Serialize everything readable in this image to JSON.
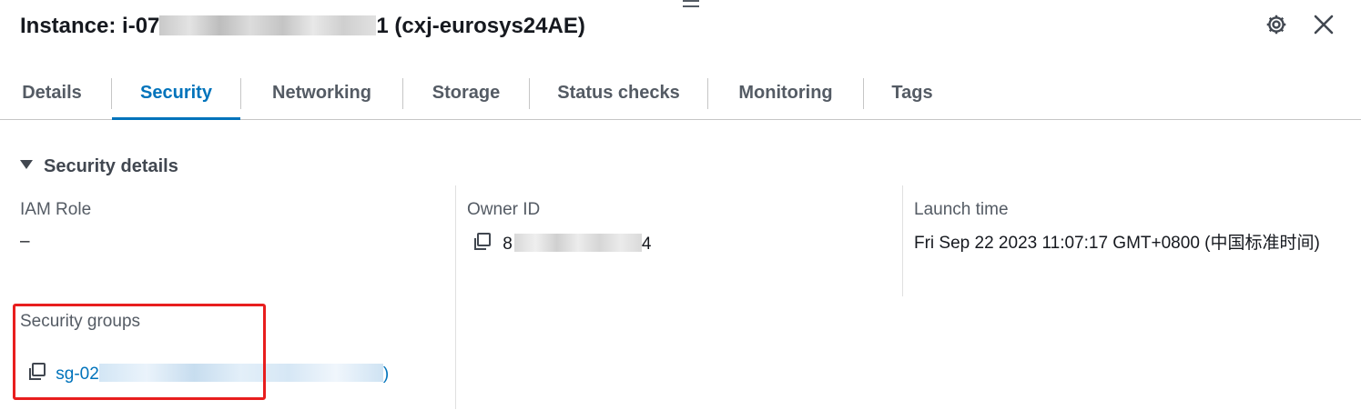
{
  "header": {
    "title_prefix": "Instance: i-07",
    "title_suffix": "1 (cxj-eurosys24AE)",
    "settings_icon": "gear-icon",
    "close_icon": "close-icon"
  },
  "tabs": [
    {
      "label": "Details",
      "active": false
    },
    {
      "label": "Security",
      "active": true
    },
    {
      "label": "Networking",
      "active": false
    },
    {
      "label": "Storage",
      "active": false
    },
    {
      "label": "Status checks",
      "active": false
    },
    {
      "label": "Monitoring",
      "active": false
    },
    {
      "label": "Tags",
      "active": false
    }
  ],
  "section": {
    "title": "Security details",
    "expanded": true
  },
  "fields": {
    "iam_role": {
      "label": "IAM Role",
      "value": "–"
    },
    "owner_id": {
      "label": "Owner ID",
      "value_prefix": "8",
      "value_suffix": "4",
      "copy_icon": "copy-icon"
    },
    "launch_time": {
      "label": "Launch time",
      "value": "Fri Sep 22 2023 11:07:17 GMT+0800 (中国标准时间)"
    },
    "security_groups": {
      "label": "Security groups",
      "link_prefix": "sg-02",
      "link_suffix": ")",
      "copy_icon": "copy-icon"
    }
  },
  "colors": {
    "link": "#0073bb",
    "active_tab": "#0073bb",
    "highlight": "#e81e1e",
    "text": "#16191f",
    "muted": "#545b64"
  }
}
